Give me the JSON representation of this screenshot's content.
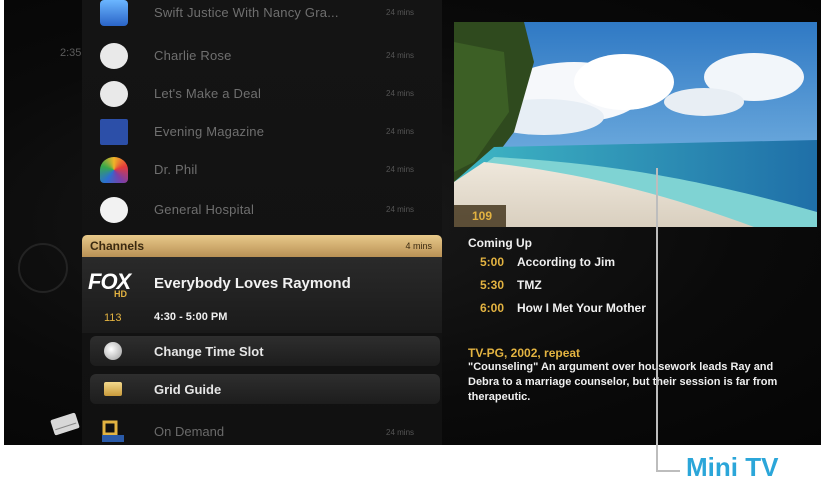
{
  "left_rail": {
    "timecode": "2:35"
  },
  "listing": {
    "rows": [
      {
        "title": "Swift Justice With Nancy Gra...",
        "duration": "24 mins",
        "logo": "mytv-logo"
      },
      {
        "title": "Charlie Rose",
        "duration": "24 mins",
        "logo": "pbs-logo"
      },
      {
        "title": "Let's Make a Deal",
        "duration": "24 mins",
        "logo": "cbs-logo"
      },
      {
        "title": "Evening Magazine",
        "duration": "24 mins",
        "logo": "kstw-logo"
      },
      {
        "title": "Dr. Phil",
        "duration": "24 mins",
        "logo": "nbc-logo"
      },
      {
        "title": "General Hospital",
        "duration": "24 mins",
        "logo": "abc-logo"
      }
    ],
    "channels_bar": {
      "label": "Channels",
      "mins": "4 mins"
    },
    "selected": {
      "network": "FOX",
      "network_sub": "HD",
      "title": "Everybody Loves Raymond",
      "channel": "113",
      "time": "4:30 - 5:00 PM"
    },
    "menu": [
      {
        "label": "Change Time Slot",
        "icon": "clock-icon"
      },
      {
        "label": "Grid Guide",
        "icon": "grid-icon"
      }
    ],
    "on_demand": {
      "title": "On Demand",
      "duration": "24 mins",
      "logo": "on-demand-logo",
      "logo_text": "On Demand"
    }
  },
  "mini_tv": {
    "channel": "109"
  },
  "info": {
    "coming_up_label": "Coming Up",
    "coming_up": [
      {
        "time": "5:00",
        "show": "According to Jim"
      },
      {
        "time": "5:30",
        "show": "TMZ"
      },
      {
        "time": "6:00",
        "show": "How I Met Your Mother"
      }
    ],
    "rating": "TV-PG, 2002, repeat",
    "description": "\"Counseling\" An argument over housework leads Ray and Debra to a marriage counselor, but their session is far from therapeutic."
  },
  "callout": {
    "label": "Mini TV"
  },
  "colors": {
    "accent_gold": "#e3b341",
    "callout_blue": "#2ba6d9"
  }
}
